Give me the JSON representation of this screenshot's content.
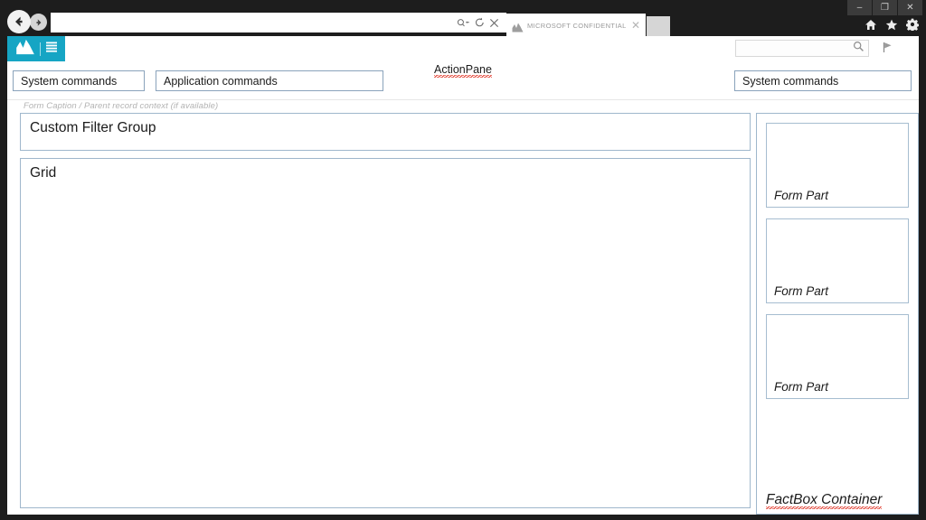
{
  "window": {
    "controls": [
      {
        "name": "minimize",
        "glyph": "–"
      },
      {
        "name": "maximize",
        "glyph": "❐"
      },
      {
        "name": "close",
        "glyph": "✕"
      }
    ]
  },
  "browser": {
    "back_icon": "back-arrow-icon",
    "forward_icon": "forward-arrow-icon",
    "address": {
      "value": "",
      "placeholder": "",
      "icons": [
        "search-dropdown-icon",
        "refresh-icon",
        "stop-icon"
      ]
    },
    "tabs": [
      {
        "title": "MICROSOFT CONFIDENTIAL",
        "icon": "dynamics-logo-icon",
        "close": "✕"
      }
    ],
    "new_tab_label": "",
    "toolbar_icons": [
      {
        "name": "home-icon",
        "glyph": "⌂"
      },
      {
        "name": "favorites-star-icon",
        "glyph": "★"
      },
      {
        "name": "tools-gear-icon",
        "glyph": "⚙"
      }
    ]
  },
  "app_nav": {
    "brand_icon": "dynamics-logo-icon",
    "menu_icon": "hamburger-menu-icon",
    "search": {
      "value": "",
      "placeholder": "",
      "icon": "search-icon"
    },
    "flag_icon": "flag-icon"
  },
  "action_pane": {
    "label": "ActionPane",
    "system_commands_left": "System commands",
    "application_commands": "Application commands",
    "system_commands_right": "System commands"
  },
  "form": {
    "caption": "Form Caption / Parent record context (if available)",
    "filter_group_title": "Custom Filter Group",
    "grid_title": "Grid"
  },
  "factbox": {
    "container_label": "FactBox Container",
    "parts": [
      {
        "label": "Form Part"
      },
      {
        "label": "Form Part"
      },
      {
        "label": "Form Part"
      }
    ]
  },
  "colors": {
    "brand_teal": "#16A5C4",
    "chrome_dark": "#1D1D1D",
    "panel_border": "#9FB7CC",
    "caption_gray": "#B3B3B3",
    "spellcheck_red": "#E03B2E"
  }
}
